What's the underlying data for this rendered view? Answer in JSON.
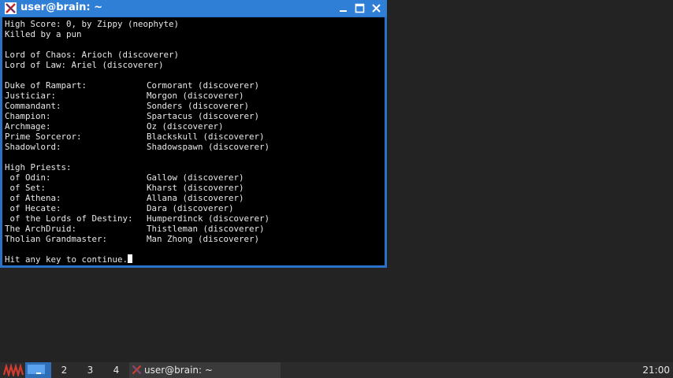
{
  "window": {
    "title": "user@brain: ~",
    "buttons": [
      "minimize-icon",
      "maximize-icon",
      "close-icon"
    ]
  },
  "terminal": {
    "header_lines": [
      "High Score: 0, by Zippy (neophyte)",
      "Killed by a pun",
      "",
      "Lord of Chaos: Arioch (discoverer)",
      "Lord of Law: Ariel (discoverer)",
      ""
    ],
    "rows_1": [
      {
        "title": "Duke of Rampart:",
        "holder": "Cormorant (discoverer)"
      },
      {
        "title": "Justiciar:",
        "holder": "Morgon (discoverer)"
      },
      {
        "title": "Commandant:",
        "holder": "Sonders (discoverer)"
      },
      {
        "title": "Champion:",
        "holder": "Spartacus (discoverer)"
      },
      {
        "title": "Archmage:",
        "holder": "Oz (discoverer)"
      },
      {
        "title": "Prime Sorceror:",
        "holder": "Blackskull (discoverer)"
      },
      {
        "title": "Shadowlord:",
        "holder": "Shadowspawn (discoverer)"
      }
    ],
    "priests_heading": "High Priests:",
    "rows_2": [
      {
        "title": " of Odin:",
        "holder": "Gallow (discoverer)"
      },
      {
        "title": " of Set:",
        "holder": "Kharst (discoverer)"
      },
      {
        "title": " of Athena:",
        "holder": "Allana (discoverer)"
      },
      {
        "title": " of Hecate:",
        "holder": "Dara (discoverer)"
      },
      {
        "title": " of the Lords of Destiny:",
        "holder": "Humperdinck (discoverer)"
      },
      {
        "title": "The ArchDruid:",
        "holder": "Thistleman (discoverer)"
      },
      {
        "title": "Tholian Grandmaster:",
        "holder": "Man Zhong (discoverer)"
      }
    ],
    "prompt": "Hit any key to continue."
  },
  "taskbar": {
    "workspaces": [
      "_",
      "2",
      "3",
      "4"
    ],
    "task_label": "user@brain: ~",
    "clock": "21:00"
  },
  "colors": {
    "titlebar": "#2f7fd6",
    "terminal_bg": "#000000",
    "terminal_fg": "#e8e8e8",
    "taskbar_bg": "#2b2b2b",
    "active_workspace": "#2f6fb7"
  }
}
